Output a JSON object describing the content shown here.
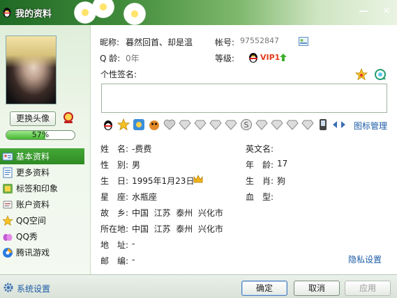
{
  "window": {
    "title": "我的资料"
  },
  "sidebar": {
    "change_avatar_label": "更换头像",
    "progress": {
      "percent_label": "57%",
      "percent": 57
    },
    "items": [
      {
        "label": "基本资料",
        "icon": "id-card-icon"
      },
      {
        "label": "更多资料",
        "icon": "document-icon"
      },
      {
        "label": "标签和印象",
        "icon": "tag-icon"
      },
      {
        "label": "账户资料",
        "icon": "account-icon"
      },
      {
        "label": "QQ空间",
        "icon": "star-space-icon"
      },
      {
        "label": "QQ秀",
        "icon": "qq-show-icon"
      },
      {
        "label": "腾讯游戏",
        "icon": "game-icon"
      }
    ]
  },
  "profile": {
    "nickname_label": "昵称:",
    "nickname": "暮然回首、却是温",
    "account_label": "帐号:",
    "account": "97552847",
    "age_label": "Q 龄:",
    "age": "0年",
    "level_label": "等级:",
    "vip_label": "VIP1",
    "signature_label": "个性签名:",
    "signature": ""
  },
  "emoticons_link": "图标管理",
  "basic": {
    "name_label": "姓　名:",
    "name": "-费费",
    "english_name_label": "英文名:",
    "english_name": "",
    "gender_label": "性　别:",
    "gender": "男",
    "age_label": "年　龄:",
    "age": "17",
    "birthday_label": "生　日:",
    "birthday": "1995年1月23日",
    "zodiac_label": "生　肖:",
    "zodiac": "狗",
    "constellation_label": "星　座:",
    "constellation": "水瓶座",
    "blood_label": "血　型:",
    "blood": "",
    "hometown_label": "故　乡:",
    "hometown": "中国  江苏  泰州  兴化市",
    "location_label": "所在地:",
    "location": "中国  江苏  泰州  兴化市",
    "address_label": "地　址:",
    "address": "-",
    "zip_label": "邮　编:",
    "zip": "-"
  },
  "privacy_link": "隐私设置",
  "footer": {
    "settings_label": "系统设置",
    "ok_label": "确定",
    "cancel_label": "取消",
    "apply_label": "应用"
  },
  "colors": {
    "accent_green": "#2f8a24",
    "link_blue": "#1d5ca6"
  }
}
